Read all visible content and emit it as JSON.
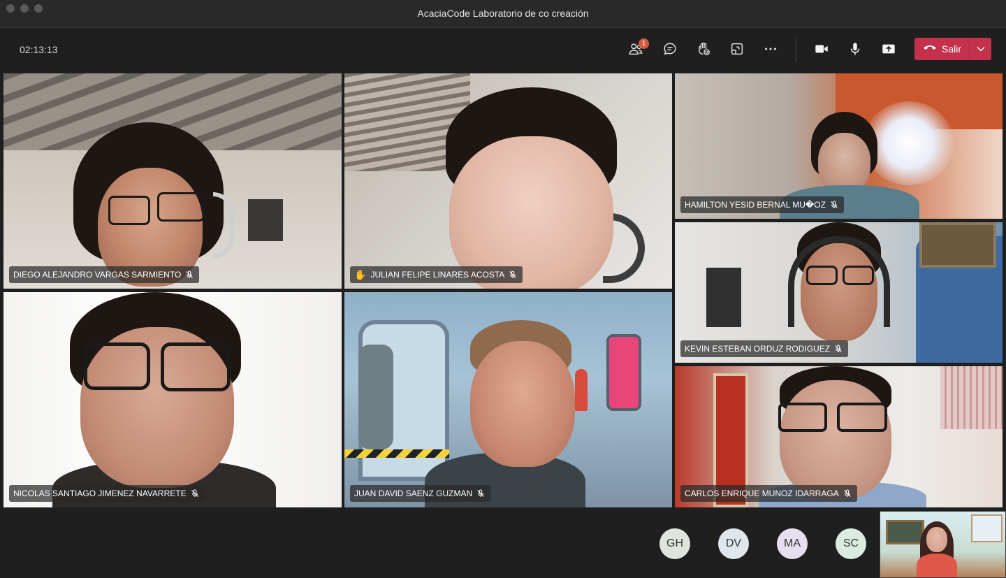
{
  "window": {
    "title": "AcaciaCode Laboratorio de co creación"
  },
  "toolbar": {
    "timer": "02:13:13",
    "participants_badge": "1",
    "leave_label": "Salir",
    "icons": [
      "participants-icon",
      "chat-icon",
      "raise-hand-icon",
      "share-tray-icon",
      "more-icon",
      "camera-icon",
      "microphone-icon",
      "share-screen-icon",
      "phone-hangup-icon",
      "chevron-down-icon"
    ]
  },
  "participants": [
    {
      "name": "DIEGO ALEJANDRO VARGAS SARMIENTO",
      "muted": true,
      "hand_raised": false
    },
    {
      "name": "JULIAN FELIPE LINARES ACOSTA",
      "muted": true,
      "hand_raised": true,
      "hand_icon": "✋"
    },
    {
      "name": "HAMILTON YESID BERNAL MU�OZ",
      "muted": true,
      "hand_raised": false
    },
    {
      "name": "KEVIN ESTEBAN ORDUZ RODIGUEZ",
      "muted": true,
      "hand_raised": false
    },
    {
      "name": "NICOLAS SANTIAGO JIMENEZ NAVARRETE",
      "muted": true,
      "hand_raised": false
    },
    {
      "name": "JUAN DAVID SAENZ GUZMAN",
      "muted": true,
      "hand_raised": false
    },
    {
      "name": "CARLOS ENRIQUE MUNOZ IDARRAGA",
      "muted": true,
      "hand_raised": false
    }
  ],
  "audio_only": [
    {
      "initials": "GH",
      "color": "#dfe5dc"
    },
    {
      "initials": "DV",
      "color": "#dfe6ee"
    },
    {
      "initials": "MA",
      "color": "#e6e0ee"
    },
    {
      "initials": "SC",
      "color": "#d9ecdf"
    }
  ],
  "colors": {
    "leave": "#c4314b",
    "badge": "#d35a3a",
    "background": "#1f1f1f"
  }
}
